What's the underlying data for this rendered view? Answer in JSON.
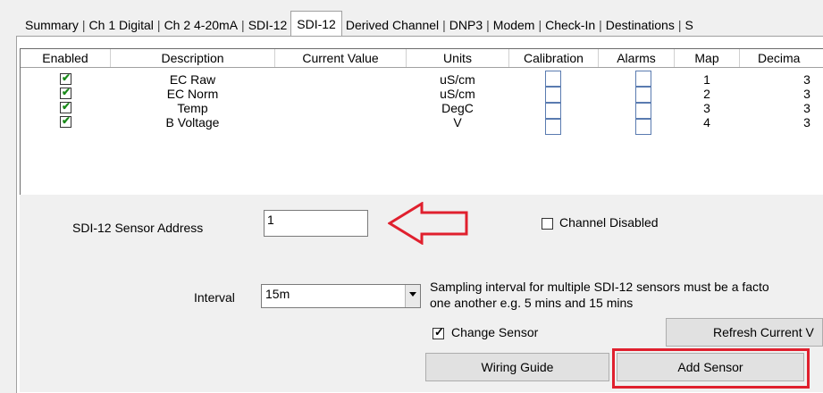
{
  "tabs": [
    {
      "label": "Summary"
    },
    {
      "label": "Ch 1 Digital"
    },
    {
      "label": "Ch 2 4-20mA"
    },
    {
      "label": "SDI-12"
    },
    {
      "label": "SDI-12",
      "active": true
    },
    {
      "label": "Derived Channel"
    },
    {
      "label": "DNP3"
    },
    {
      "label": "Modem"
    },
    {
      "label": "Check-In"
    },
    {
      "label": "Destinations"
    },
    {
      "label": "S"
    }
  ],
  "grid": {
    "headers": [
      "Enabled",
      "Description",
      "Current Value",
      "Units",
      "Calibration",
      "Alarms",
      "Map",
      "Decima"
    ],
    "rows": [
      {
        "enabled": true,
        "description": "EC Raw",
        "current_value": "",
        "units": "uS/cm",
        "calibration": false,
        "alarms": false,
        "map": "1",
        "decimals": "3"
      },
      {
        "enabled": true,
        "description": "EC Norm",
        "current_value": "",
        "units": "uS/cm",
        "calibration": false,
        "alarms": false,
        "map": "2",
        "decimals": "3"
      },
      {
        "enabled": true,
        "description": "Temp",
        "current_value": "",
        "units": "DegC",
        "calibration": false,
        "alarms": false,
        "map": "3",
        "decimals": "3"
      },
      {
        "enabled": true,
        "description": "B Voltage",
        "current_value": "",
        "units": "V",
        "calibration": false,
        "alarms": false,
        "map": "4",
        "decimals": "3"
      }
    ]
  },
  "form": {
    "address_label": "SDI-12 Sensor Address",
    "address_value": "1",
    "channel_disabled_label": "Channel Disabled",
    "channel_disabled_checked": false,
    "interval_label": "Interval",
    "interval_value": "15m",
    "interval_note_line1": "Sampling interval for multiple SDI-12 sensors must be a facto",
    "interval_note_line2": "one another e.g. 5 mins and 15 mins",
    "change_sensor_label": "Change Sensor",
    "change_sensor_checked": true
  },
  "buttons": {
    "refresh": "Refresh Current V",
    "wiring_guide": "Wiring Guide",
    "add_sensor": "Add Sensor"
  },
  "annotation_colors": {
    "highlight": "#e0202e"
  }
}
